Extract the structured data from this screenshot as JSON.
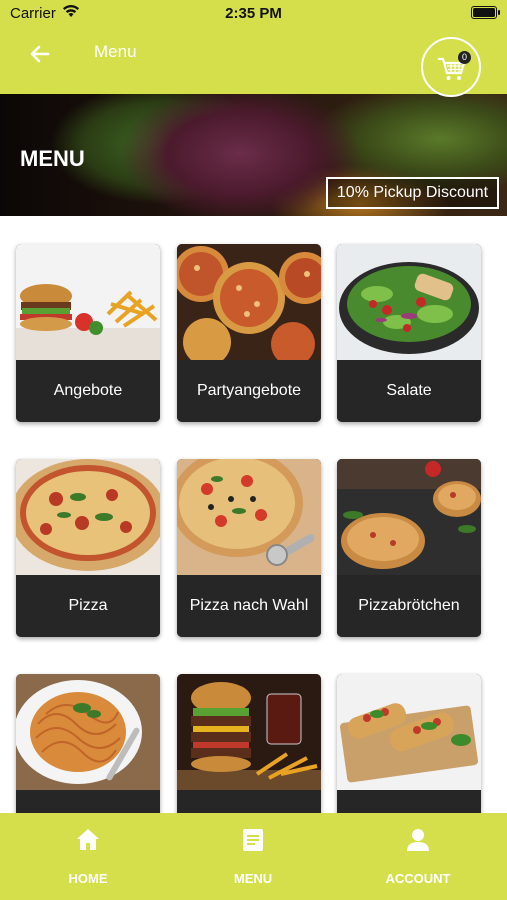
{
  "status_bar": {
    "carrier": "Carrier",
    "time": "2:35 PM"
  },
  "header": {
    "title": "Menu",
    "cart_count": "0"
  },
  "banner": {
    "title": "MENU",
    "badge": "10% Pickup Discount"
  },
  "categories": [
    {
      "label": "Angebote"
    },
    {
      "label": "Partyangebote"
    },
    {
      "label": "Salate"
    },
    {
      "label": "Pizza"
    },
    {
      "label": "Pizza nach Wahl"
    },
    {
      "label": "Pizzabrötchen"
    },
    {
      "label": ""
    },
    {
      "label": ""
    },
    {
      "label": ""
    }
  ],
  "tabbar": {
    "home": "HOME",
    "menu": "MENU",
    "account": "ACCOUNT"
  },
  "colors": {
    "accent": "#d4df4b",
    "card_label_bg": "#262626",
    "text_light": "#ffffff"
  }
}
